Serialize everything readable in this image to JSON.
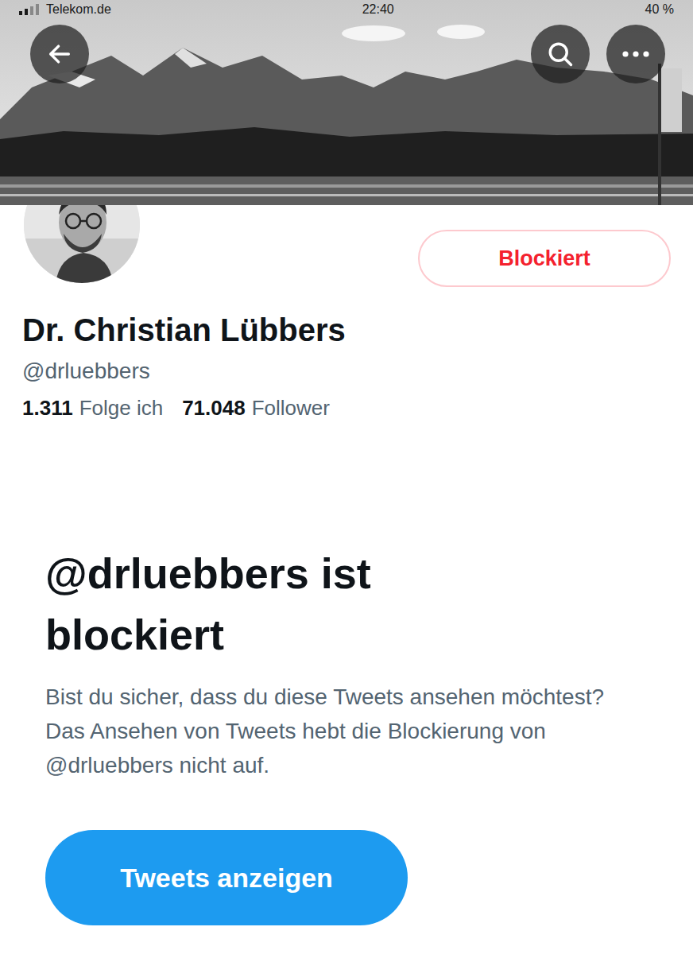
{
  "status_bar": {
    "carrier": "Telekom.de",
    "time": "22:40",
    "battery": "40 %"
  },
  "profile": {
    "name": "Dr. Christian Lübbers",
    "handle": "@drluebbers",
    "following_count": "1.311",
    "following_label": "Folge ich",
    "followers_count": "71.048",
    "followers_label": "Follower",
    "block_button": "Blockiert",
    "blocked": true
  },
  "notice": {
    "title": "@drluebbers ist blockiert",
    "text": "Bist du sicher, dass du diese Tweets ansehen möchtest? Das Ansehen von Tweets hebt die Blockierung von @drluebbers nicht auf.",
    "button": "Tweets anzeigen"
  }
}
